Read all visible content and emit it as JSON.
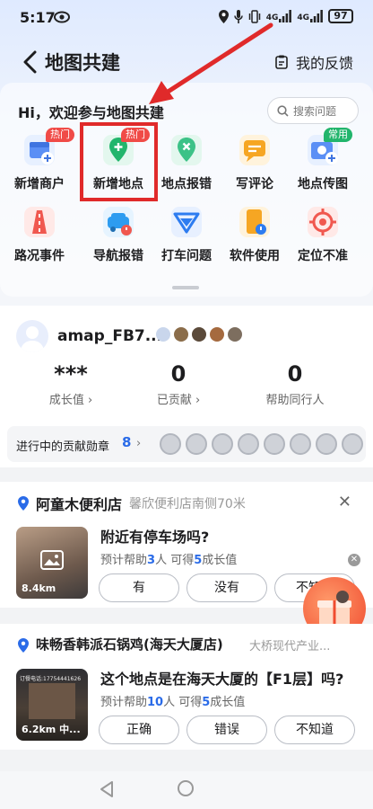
{
  "status_bar": {
    "time": "5:17",
    "signal_1": "4G",
    "signal_2": "4G",
    "battery": "97"
  },
  "header": {
    "title": "地图共建",
    "feedback_label": "我的反馈"
  },
  "main": {
    "greeting": "Hi，欢迎参与地图共建",
    "search_placeholder": "搜索问题",
    "tools": [
      {
        "label": "新增商户",
        "badge": "热门"
      },
      {
        "label": "新增地点",
        "badge": "热门"
      },
      {
        "label": "地点报错"
      },
      {
        "label": "写评论"
      },
      {
        "label": "地点传图",
        "badge": "常用"
      },
      {
        "label": "路况事件"
      },
      {
        "label": "导航报错"
      },
      {
        "label": "打车问题"
      },
      {
        "label": "软件使用"
      },
      {
        "label": "定位不准"
      }
    ],
    "colors": {
      "accent": "#2a6be8",
      "highlight": "#e02a2a",
      "hot": "#f04b47",
      "common": "#22b56c"
    }
  },
  "profile": {
    "username": "amap_FB7...",
    "stats": [
      {
        "value": "***",
        "label": "成长值 ›"
      },
      {
        "value": "0",
        "label": "已贡献 ›"
      },
      {
        "value": "0",
        "label": "帮助同行人"
      }
    ],
    "medals_label": "进行中的贡献勋章",
    "medals_count": "8"
  },
  "tasks": [
    {
      "place": "阿童木便利店",
      "place_sub": "馨欣便利店南侧70米",
      "distance": "8.4km",
      "question": "附近有停车场吗?",
      "meta_pre": "预计帮助",
      "meta_num1": "3",
      "meta_mid": "人  可得",
      "meta_num2": "5",
      "meta_post": "成长值",
      "answers": [
        "有",
        "没有",
        "不知道"
      ]
    },
    {
      "place": "味畅香韩派石锅鸡(海天大厦店)",
      "place_sub": "大桥现代产业...",
      "distance": "6.2km",
      "thumb_caption": "中...",
      "thumb_phone": "订餐电话:17754441626",
      "question": "这个地点是在海天大厦的【F1层】吗?",
      "meta_pre": "预计帮助",
      "meta_num1": "10",
      "meta_mid": "人  可得",
      "meta_num2": "5",
      "meta_post": "成长值",
      "answers": [
        "正确",
        "错误",
        "不知道"
      ]
    }
  ]
}
